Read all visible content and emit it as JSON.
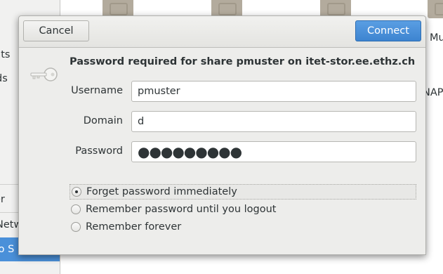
{
  "background": {
    "sidebar_items": [
      "nts",
      "ds",
      "er",
      "Netw",
      "to S"
    ],
    "folder_labels": [
      "Mu",
      "NAP"
    ]
  },
  "dialog": {
    "cancel_label": "Cancel",
    "connect_label": "Connect",
    "heading": "Password required for share pmuster on itet-stor.ee.ethz.ch",
    "username_label": "Username",
    "username_value": "pmuster",
    "domain_label": "Domain",
    "domain_value": "d",
    "password_label": "Password",
    "password_mask": "●●●●●●●●●",
    "options": [
      {
        "label": "Forget password immediately",
        "selected": true
      },
      {
        "label": "Remember password until you logout",
        "selected": false
      },
      {
        "label": "Remember forever",
        "selected": false
      }
    ]
  },
  "colors": {
    "accent": "#4a90d9",
    "connect_button": "#3d84d0"
  }
}
